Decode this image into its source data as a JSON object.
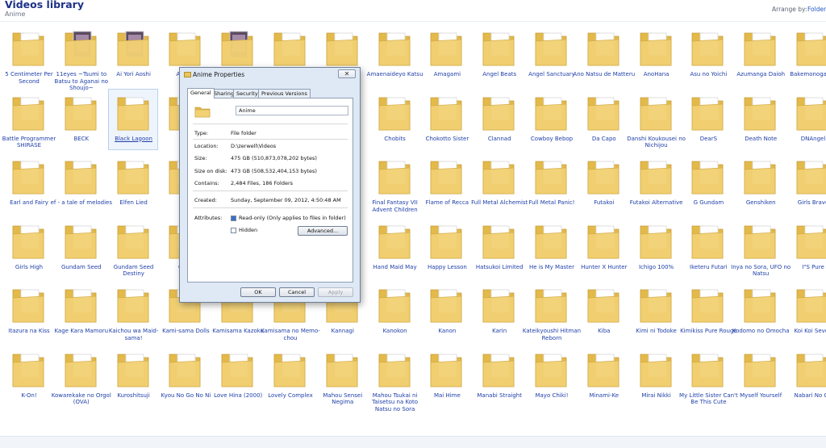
{
  "library": {
    "title": "Videos library",
    "subtitle": "Anime",
    "arrange_label": "Arrange by:",
    "arrange_value": "Folder"
  },
  "folders": [
    {
      "label": "5 Centimeter Per Second",
      "thumb": "plain"
    },
    {
      "label": "11eyes ~Tsumi to Batsu to Aganai no Shoujo~",
      "thumb": "image"
    },
    {
      "label": "Ai Yori Aoshi",
      "thumb": "image"
    },
    {
      "label": "Aishite",
      "thumb": "plain"
    },
    {
      "label": "",
      "thumb": "image"
    },
    {
      "label": "",
      "thumb": "plain"
    },
    {
      "label": "",
      "thumb": "plain"
    },
    {
      "label": "Amaenaideyo Katsu",
      "thumb": "plain"
    },
    {
      "label": "Amagami",
      "thumb": "plain"
    },
    {
      "label": "Angel Beats",
      "thumb": "plain"
    },
    {
      "label": "Angel Sanctuary",
      "thumb": "plain"
    },
    {
      "label": "Ano Natsu de Matteru",
      "thumb": "plain"
    },
    {
      "label": "AnoHana",
      "thumb": "plain"
    },
    {
      "label": "Asu no Yoichi",
      "thumb": "plain"
    },
    {
      "label": "Azumanga Daioh",
      "thumb": "plain"
    },
    {
      "label": "Bakemonogatari",
      "thumb": "plain"
    },
    {
      "label": "Battle Programmer SHIRASE",
      "thumb": "plain"
    },
    {
      "label": "BECK",
      "thumb": "plain"
    },
    {
      "label": "Black Lagoon",
      "thumb": "plain",
      "selected": true
    },
    {
      "label": "Bl",
      "thumb": "plain"
    },
    {
      "label": "",
      "thumb": "plain"
    },
    {
      "label": "",
      "thumb": "plain"
    },
    {
      "label": "",
      "thumb": "plain"
    },
    {
      "label": "Chobits",
      "thumb": "plain"
    },
    {
      "label": "Chokotto Sister",
      "thumb": "plain"
    },
    {
      "label": "Clannad",
      "thumb": "plain"
    },
    {
      "label": "Cowboy Bebop",
      "thumb": "plain"
    },
    {
      "label": "Da Capo",
      "thumb": "plain"
    },
    {
      "label": "Danshi Koukousei no Nichijou",
      "thumb": "plain"
    },
    {
      "label": "DearS",
      "thumb": "plain"
    },
    {
      "label": "Death Note",
      "thumb": "plain"
    },
    {
      "label": "DNAngel",
      "thumb": "plain"
    },
    {
      "label": "Earl and Fairy",
      "thumb": "plain"
    },
    {
      "label": "ef - a tale of melodies",
      "thumb": "plain"
    },
    {
      "label": "Elfen Lied",
      "thumb": "plain"
    },
    {
      "label": "Esc",
      "thumb": "plain"
    },
    {
      "label": "",
      "thumb": "plain"
    },
    {
      "label": "",
      "thumb": "plain"
    },
    {
      "label": "",
      "thumb": "plain"
    },
    {
      "label": "Final Fantasy VII Advent Children",
      "thumb": "plain"
    },
    {
      "label": "Flame of Recca",
      "thumb": "plain"
    },
    {
      "label": "Full Metal Alchemist",
      "thumb": "plain"
    },
    {
      "label": "Full Metal Panic!",
      "thumb": "plain"
    },
    {
      "label": "Futakoi",
      "thumb": "plain"
    },
    {
      "label": "Futakoi Alternative",
      "thumb": "plain"
    },
    {
      "label": "G Gundam",
      "thumb": "plain"
    },
    {
      "label": "Genshiken",
      "thumb": "plain"
    },
    {
      "label": "Girls Bravo",
      "thumb": "plain"
    },
    {
      "label": "Girls High",
      "thumb": "plain"
    },
    {
      "label": "Gundam Seed",
      "thumb": "plain"
    },
    {
      "label": "Gundam Seed Destiny",
      "thumb": "plain"
    },
    {
      "label": "Gund",
      "thumb": "plain"
    },
    {
      "label": "",
      "thumb": "plain"
    },
    {
      "label": "",
      "thumb": "plain"
    },
    {
      "label": "",
      "thumb": "plain"
    },
    {
      "label": "Hand Maid May",
      "thumb": "plain"
    },
    {
      "label": "Happy Lesson",
      "thumb": "plain"
    },
    {
      "label": "Hatsukoi Limited",
      "thumb": "plain"
    },
    {
      "label": "He is My Master",
      "thumb": "plain"
    },
    {
      "label": "Hunter X Hunter",
      "thumb": "plain"
    },
    {
      "label": "Ichigo 100%",
      "thumb": "plain"
    },
    {
      "label": "Iketeru Futari",
      "thumb": "plain"
    },
    {
      "label": "Inya no Sora, UFO no Natsu",
      "thumb": "plain"
    },
    {
      "label": "I\"S Pure",
      "thumb": "plain"
    },
    {
      "label": "Itazura na Kiss",
      "thumb": "plain"
    },
    {
      "label": "Kage Kara Mamoru",
      "thumb": "plain"
    },
    {
      "label": "Kaichou wa Maid-sama!",
      "thumb": "plain"
    },
    {
      "label": "Kami-sama Dolls",
      "thumb": "plain"
    },
    {
      "label": "Kamisama Kazoku",
      "thumb": "plain"
    },
    {
      "label": "Kamisama no Memo-chou",
      "thumb": "plain"
    },
    {
      "label": "Kannagi",
      "thumb": "plain"
    },
    {
      "label": "Kanokon",
      "thumb": "plain"
    },
    {
      "label": "Kanon",
      "thumb": "plain"
    },
    {
      "label": "Karin",
      "thumb": "plain"
    },
    {
      "label": "Kateikyoushi Hitman Reborn",
      "thumb": "plain"
    },
    {
      "label": "Kiba",
      "thumb": "plain"
    },
    {
      "label": "Kimi ni Todoke",
      "thumb": "plain"
    },
    {
      "label": "Kimikiss Pure Rouge",
      "thumb": "plain"
    },
    {
      "label": "Kodomo no Omocha",
      "thumb": "plain"
    },
    {
      "label": "Koi Koi Seven",
      "thumb": "plain"
    },
    {
      "label": "K-On!",
      "thumb": "plain"
    },
    {
      "label": "Kowarekake no Orgol (OVA)",
      "thumb": "plain"
    },
    {
      "label": "Kuroshitsuji",
      "thumb": "plain"
    },
    {
      "label": "Kyou No Go No Ni",
      "thumb": "plain"
    },
    {
      "label": "Love Hina (2000)",
      "thumb": "plain"
    },
    {
      "label": "Lovely Complex",
      "thumb": "plain"
    },
    {
      "label": "Mahou Sensei Negima",
      "thumb": "plain"
    },
    {
      "label": "Mahou Tsukai ni Taisetsu na Koto Natsu no Sora",
      "thumb": "plain"
    },
    {
      "label": "Mai Hime",
      "thumb": "plain"
    },
    {
      "label": "Manabi Straight",
      "thumb": "plain"
    },
    {
      "label": "Mayo Chiki!",
      "thumb": "plain"
    },
    {
      "label": "Minami-Ke",
      "thumb": "plain"
    },
    {
      "label": "Mirai Nikki",
      "thumb": "plain"
    },
    {
      "label": "My Little Sister Can't Be This Cute",
      "thumb": "plain"
    },
    {
      "label": "Myself Yourself",
      "thumb": "plain"
    },
    {
      "label": "Nabari No Ou",
      "thumb": "plain"
    }
  ],
  "dialog": {
    "title": "Anime Properties",
    "close_glyph": "✕",
    "tabs": [
      "General",
      "Sharing",
      "Security",
      "Previous Versions"
    ],
    "folder_name": "Anime",
    "type_label": "Type:",
    "type_value": "File folder",
    "location_label": "Location:",
    "location_value": "D:\\zerwell\\Videos",
    "size_label": "Size:",
    "size_value": "475 GB (510,873,078,202 bytes)",
    "size_on_disk_label": "Size on disk:",
    "size_on_disk_value": "473 GB (508,532,404,153 bytes)",
    "contains_label": "Contains:",
    "contains_value": "2,484 Files, 186 Folders",
    "created_label": "Created:",
    "created_value": "Sunday, September 09, 2012, 4:50:48 AM",
    "attributes_label": "Attributes:",
    "readonly_label": "Read-only (Only applies to files in folder)",
    "hidden_label": "Hidden",
    "advanced_label": "Advanced...",
    "ok_label": "OK",
    "cancel_label": "Cancel",
    "apply_label": "Apply"
  },
  "colors": {
    "folder_body": "#f2d173",
    "folder_back": "#e3b94a",
    "link_text": "#1f3fa8"
  }
}
